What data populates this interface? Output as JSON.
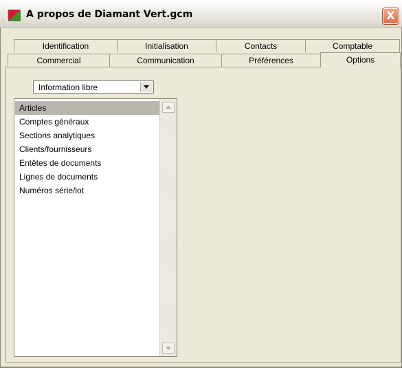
{
  "window": {
    "title": "A propos de Diamant Vert.gcm",
    "close_label": "X",
    "colors": {
      "icon_red": "#D0102A",
      "icon_green": "#3E8E2A",
      "close": "#E26B45"
    }
  },
  "tabs_row1": [
    "Identification",
    "Initialisation",
    "Contacts",
    "Comptable"
  ],
  "tabs_row2": [
    "Commercial",
    "Communication",
    "Préférences",
    "Options"
  ],
  "active_tab": "Options",
  "combo": {
    "value": "Information libre",
    "icon": "chevron-down-icon"
  },
  "list": {
    "items": [
      "Articles",
      "Comptes généraux",
      "Sections analytiques",
      "Clients/fournisseurs",
      "Entêtes de documents",
      "Lignes de documents",
      "Numéros série/lot"
    ],
    "selected": "Articles"
  }
}
